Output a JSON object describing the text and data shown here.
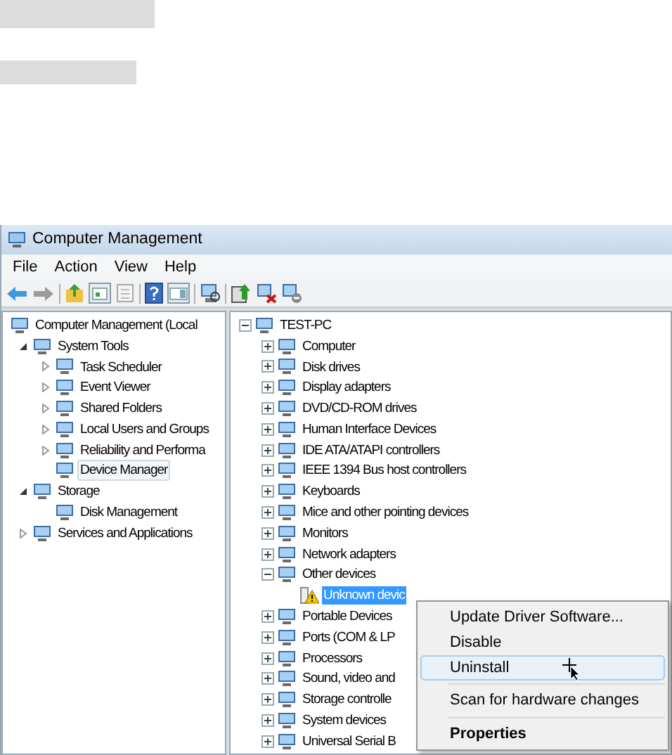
{
  "window": {
    "title": "Computer Management"
  },
  "menu": [
    "File",
    "Action",
    "View",
    "Help"
  ],
  "console_tree": [
    {
      "label": "Computer Management (Local",
      "selected": false,
      "children": [
        {
          "label": "System Tools",
          "expanded": true,
          "selected": false,
          "children": [
            {
              "label": "Task Scheduler",
              "expanded": false,
              "selected": false
            },
            {
              "label": "Event Viewer",
              "expanded": false,
              "selected": false
            },
            {
              "label": "Shared Folders",
              "expanded": false,
              "selected": false
            },
            {
              "label": "Local Users and Groups",
              "expanded": false,
              "selected": false
            },
            {
              "label": "Reliability and Performa",
              "expanded": false,
              "selected": false
            },
            {
              "label": "Device Manager",
              "selected": true
            }
          ]
        },
        {
          "label": "Storage",
          "expanded": true,
          "selected": false,
          "children": [
            {
              "label": "Disk Management",
              "selected": false
            }
          ]
        },
        {
          "label": "Services and Applications",
          "expanded": false,
          "selected": false
        }
      ]
    }
  ],
  "device_tree": [
    {
      "label": "TEST-PC",
      "expanded": true,
      "selected": false,
      "children": [
        {
          "label": "Computer",
          "expanded": false,
          "selected": false
        },
        {
          "label": "Disk drives",
          "expanded": false,
          "selected": false
        },
        {
          "label": "Display adapters",
          "expanded": false,
          "selected": false
        },
        {
          "label": "DVD/CD-ROM drives",
          "expanded": false,
          "selected": false
        },
        {
          "label": "Human Interface Devices",
          "expanded": false,
          "selected": false
        },
        {
          "label": "IDE ATA/ATAPI controllers",
          "expanded": false,
          "selected": false
        },
        {
          "label": "IEEE 1394 Bus host controllers",
          "expanded": false,
          "selected": false
        },
        {
          "label": "Keyboards",
          "expanded": false,
          "selected": false
        },
        {
          "label": "Mice and other pointing devices",
          "expanded": false,
          "selected": false
        },
        {
          "label": "Monitors",
          "expanded": false,
          "selected": false
        },
        {
          "label": "Network adapters",
          "expanded": false,
          "selected": false
        },
        {
          "label": "Other devices",
          "expanded": true,
          "selected": false,
          "children": [
            {
              "label": "Unknown devic",
              "selected": true,
              "problem": true
            }
          ]
        },
        {
          "label": "Portable Devices",
          "expanded": false,
          "selected": false
        },
        {
          "label": "Ports (COM & LP",
          "expanded": false,
          "selected": false
        },
        {
          "label": "Processors",
          "expanded": false,
          "selected": false
        },
        {
          "label": "Sound, video and",
          "expanded": false,
          "selected": false
        },
        {
          "label": "Storage controlle",
          "expanded": false,
          "selected": false
        },
        {
          "label": "System devices",
          "expanded": false,
          "selected": false
        },
        {
          "label": "Universal Serial B",
          "expanded": false,
          "selected": false
        }
      ]
    }
  ],
  "context_menu": [
    {
      "kind": "item",
      "label": "Update Driver Software...",
      "selected": false,
      "default": false
    },
    {
      "kind": "item",
      "label": "Disable",
      "selected": false,
      "default": false
    },
    {
      "kind": "item",
      "label": "Uninstall",
      "selected": true,
      "default": false
    },
    {
      "kind": "separator"
    },
    {
      "kind": "item",
      "label": "Scan for hardware changes",
      "selected": false,
      "default": false
    },
    {
      "kind": "separator"
    },
    {
      "kind": "item",
      "label": "Properties",
      "selected": false,
      "default": true
    }
  ]
}
